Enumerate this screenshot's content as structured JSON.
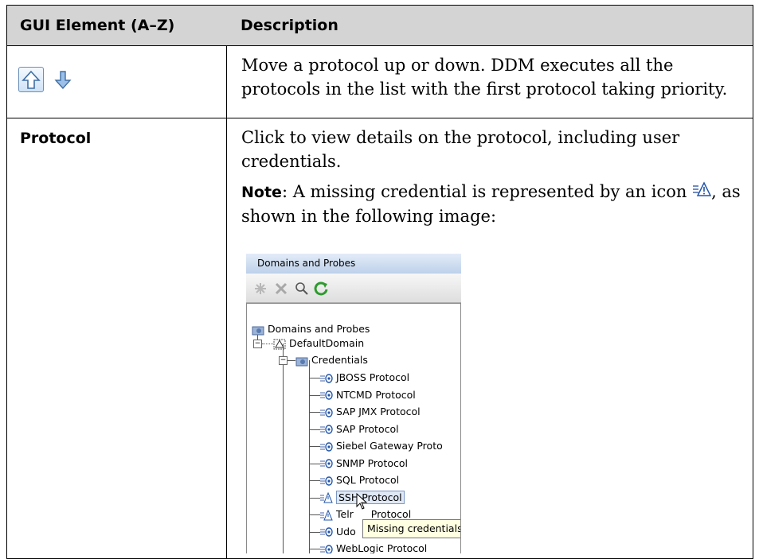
{
  "table": {
    "headers": [
      "GUI Element (A–Z)",
      "Description"
    ],
    "rows": [
      {
        "element_icons": [
          "arrow-up-icon",
          "arrow-down-icon"
        ],
        "description": "Move a protocol up or down. DDM executes all the protocols in the list with the first protocol taking priority."
      },
      {
        "element": "Protocol",
        "description": "Click to view details on the protocol, including user credentials.",
        "note_label": "Note",
        "note_text": ": A missing credential is represented by an icon",
        "note_text_2": ", as shown in the following image:"
      }
    ]
  },
  "screenshot": {
    "panel_title": "Domains and Probes",
    "toolbar_icons": [
      "new-icon",
      "delete-icon",
      "search-icon",
      "refresh-icon"
    ],
    "tree": {
      "root": "Domains and Probes",
      "domain": "DefaultDomain",
      "folder": "Credentials",
      "protocols": [
        "JBOSS Protocol",
        "NTCMD Protocol",
        "SAP JMX Protocol",
        "SAP Protocol",
        "Siebel Gateway Proto",
        "SNMP Protocol",
        "SQL Protocol",
        "SSH Protocol",
        "Telnet Protocol",
        "Udp Protocol",
        "WebLogic Protocol"
      ],
      "visible_protocols": [
        "JBOSS Protocol",
        "NTCMD Protocol",
        "SAP JMX Protocol",
        "SAP Protocol",
        "Siebel Gateway Proto",
        "SNMP Protocol",
        "SQL Protocol",
        "SSH Protocol",
        "Telr",
        "Udo",
        "WebLogic Protocol"
      ],
      "telnet_tail": "Protocol"
    },
    "tooltip": "Missing credentials"
  },
  "colors": {
    "header_bg": "#d4d4d4",
    "border": "#000000",
    "tooltip_bg": "#ffffe1",
    "selection_bg": "#dfe8f6"
  }
}
